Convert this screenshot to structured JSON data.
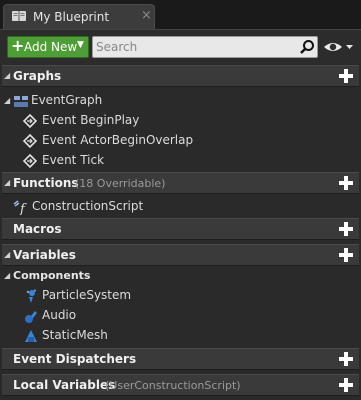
{
  "tab": {
    "title": "My Blueprint",
    "close": "×",
    "icon": "book-icon"
  },
  "toolbar": {
    "add_label": "Add New",
    "search_placeholder": "Search"
  },
  "graphs": {
    "title": "Graphs",
    "event_graph": "EventGraph",
    "events": [
      "Event BeginPlay",
      "Event ActorBeginOverlap",
      "Event Tick"
    ]
  },
  "functions": {
    "title": "Functions",
    "sub": "(18 Overridable)",
    "items": [
      "ConstructionScript"
    ]
  },
  "macros": {
    "title": "Macros"
  },
  "variables": {
    "title": "Variables",
    "components_title": "Components",
    "components": [
      "ParticleSystem",
      "Audio",
      "StaticMesh"
    ]
  },
  "dispatchers": {
    "title": "Event Dispatchers"
  },
  "local_variables": {
    "title": "Local Variables",
    "sub": "(UserConstructionScript)"
  },
  "colors": {
    "accent_green": "#4f9d36",
    "section_bg": "#3a3a3a",
    "panel_bg": "#2a2a2a"
  }
}
